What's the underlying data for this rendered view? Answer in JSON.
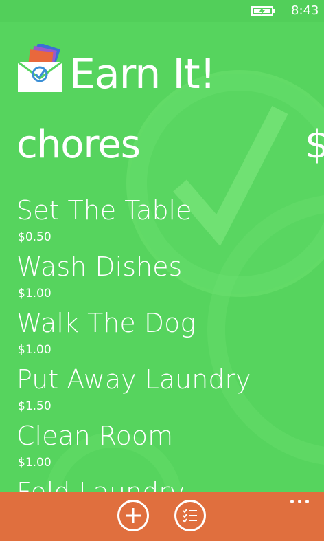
{
  "colors": {
    "background": "#56d45e",
    "accent_bar": "#e06f3e",
    "text": "#ffffff"
  },
  "status_bar": {
    "battery_icon": "battery-charging-icon",
    "time": "8:43"
  },
  "app": {
    "logo_icon": "envelope-checkmark-logo-icon",
    "title": "Earn It!"
  },
  "pivot": {
    "current": "chores",
    "next_peek": "$"
  },
  "chores": [
    {
      "name": "Set The Table",
      "price": "$0.50"
    },
    {
      "name": "Wash Dishes",
      "price": "$1.00"
    },
    {
      "name": "Walk The Dog",
      "price": "$1.00"
    },
    {
      "name": "Put Away Laundry",
      "price": "$1.50"
    },
    {
      "name": "Clean Room",
      "price": "$1.00"
    },
    {
      "name": "Fold Laundry",
      "price": ""
    }
  ],
  "app_bar": {
    "add_icon": "add-circle-icon",
    "list_icon": "checklist-icon",
    "more_icon": "ellipsis-icon"
  }
}
